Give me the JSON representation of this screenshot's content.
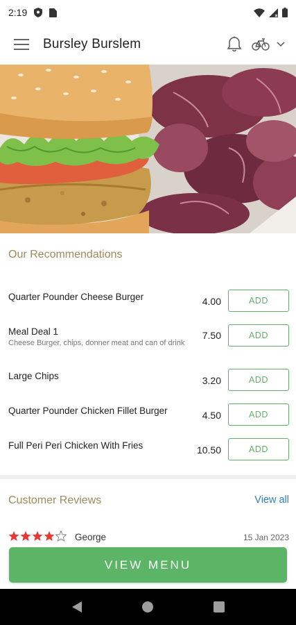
{
  "status_bar": {
    "time": "2:19",
    "icons": [
      "shield-icon",
      "sim-card-icon",
      "wifi-icon",
      "signal-icon",
      "battery-icon"
    ]
  },
  "app_bar": {
    "title": "Bursley Burslem",
    "icons": [
      "hamburger-menu-icon",
      "bell-icon",
      "bicycle-icon",
      "chevron-down-icon"
    ]
  },
  "hero": {
    "image": "burger-and-purple-crisps-photo"
  },
  "recommendations": {
    "title": "Our Recommendations",
    "items": [
      {
        "name": "Quarter Pounder Cheese Burger",
        "description": "",
        "price": "4.00",
        "add_label": "ADD"
      },
      {
        "name": "Meal Deal 1",
        "description": "Cheese Burger, chips, donner meat and can of drink",
        "price": "7.50",
        "add_label": "ADD"
      },
      {
        "name": "Large Chips",
        "description": "",
        "price": "3.20",
        "add_label": "ADD"
      },
      {
        "name": "Quarter Pounder Chicken Fillet Burger",
        "description": "",
        "price": "4.50",
        "add_label": "ADD"
      },
      {
        "name": "Full Peri Peri Chicken With Fries",
        "description": "",
        "price": "10.50",
        "add_label": "ADD"
      }
    ]
  },
  "reviews": {
    "title": "Customer Reviews",
    "view_all_label": "View all",
    "items": [
      {
        "rating": 4,
        "max_rating": 5,
        "reviewer": "George",
        "date": "15 Jan 2023"
      }
    ]
  },
  "view_menu_button": {
    "label": "VIEW MENU"
  },
  "colors": {
    "accent_green": "#5cb466",
    "section_title_gold": "#a08a5c",
    "link_blue": "#2f7fbf",
    "star_red": "#e53935"
  },
  "navigation_bar": {
    "icons": [
      "back-icon",
      "home-icon",
      "recents-icon"
    ]
  }
}
